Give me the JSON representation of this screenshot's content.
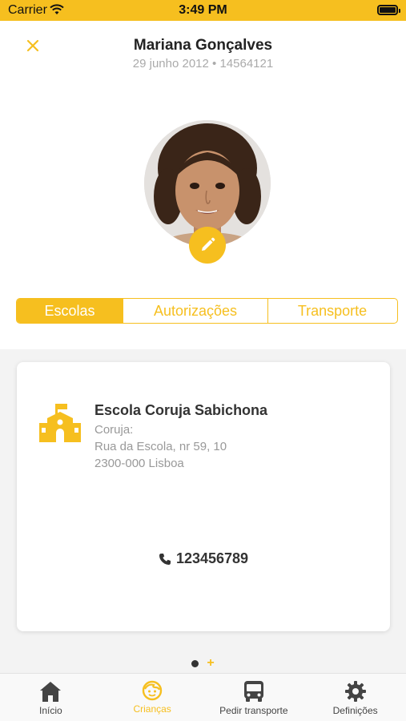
{
  "status_bar": {
    "carrier": "Carrier",
    "time": "3:49 PM"
  },
  "header": {
    "name": "Mariana Gonçalves",
    "subtitle": "29 junho 2012 • 14564121"
  },
  "segments": [
    "Escolas",
    "Autorizações",
    "Transporte"
  ],
  "active_segment": "Escolas",
  "school": {
    "name": "Escola Coruja Sabichona",
    "label": "Coruja:",
    "address_line1": "Rua da Escola, nr 59, 10",
    "address_line2": "2300-000 Lisboa",
    "phone": "123456789"
  },
  "pager": {
    "plus": "+"
  },
  "tabs": [
    {
      "label": "Início",
      "icon": "home-icon"
    },
    {
      "label": "Crianças",
      "icon": "child-face-icon"
    },
    {
      "label": "Pedir transporte",
      "icon": "bus-icon"
    },
    {
      "label": "Definições",
      "icon": "gear-icon"
    }
  ],
  "colors": {
    "accent": "#f6bf1f",
    "text": "#333333",
    "muted": "#999999"
  }
}
